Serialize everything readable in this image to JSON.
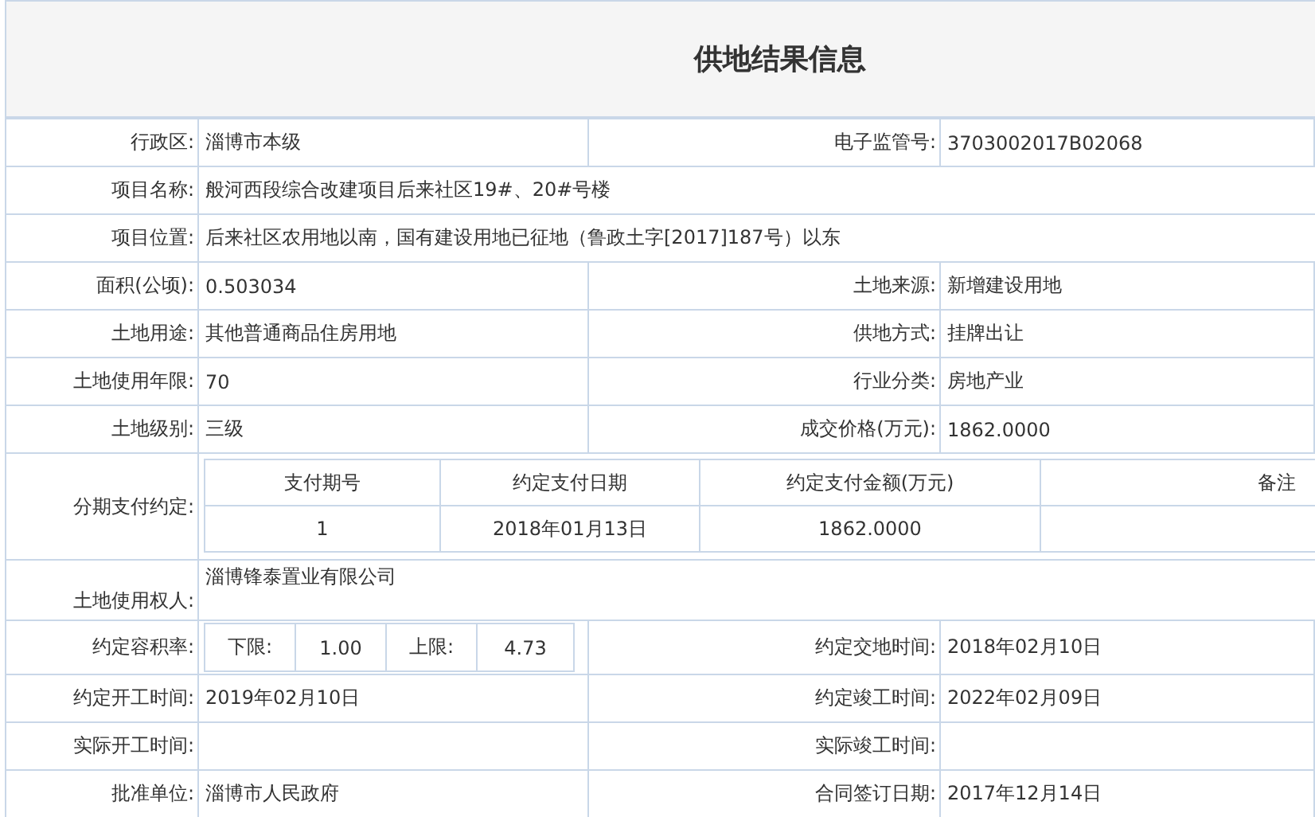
{
  "title": "供地结果信息",
  "rows": [
    {
      "kind": "pair",
      "cells": [
        {
          "label": "行政区:",
          "value": "淄博市本级"
        },
        {
          "label": "电子监管号:",
          "value": "3703002017B02068"
        }
      ]
    },
    {
      "kind": "wide",
      "label": "项目名称:",
      "value": "般河西段综合改建项目后来社区19#、20#号楼"
    },
    {
      "kind": "wide",
      "label": "项目位置:",
      "value": "后来社区农用地以南，国有建设用地已征地（鲁政土字[2017]187号）以东"
    },
    {
      "kind": "pair",
      "cells": [
        {
          "label": "面积(公顷):",
          "value": "0.503034"
        },
        {
          "label": "土地来源:",
          "value": "新增建设用地"
        }
      ]
    },
    {
      "kind": "pair",
      "cells": [
        {
          "label": "土地用途:",
          "value": "其他普通商品住房用地"
        },
        {
          "label": "供地方式:",
          "value": "挂牌出让"
        }
      ]
    },
    {
      "kind": "pair",
      "cells": [
        {
          "label": "土地使用年限:",
          "value": "70"
        },
        {
          "label": "行业分类:",
          "value": "房地产业"
        }
      ]
    },
    {
      "kind": "pair",
      "cells": [
        {
          "label": "土地级别:",
          "value": "三级"
        },
        {
          "label": "成交价格(万元):",
          "value": "1862.0000"
        }
      ]
    },
    {
      "kind": "installments",
      "label": "分期支付约定:",
      "columns": [
        "支付期号",
        "约定支付日期",
        "约定支付金额(万元)",
        "备注"
      ],
      "rows": [
        [
          "1",
          "2018年01月13日",
          "1862.0000"
        ]
      ]
    },
    {
      "kind": "owner",
      "label": "土地使用权人:",
      "value": "淄博锋泰置业有限公司"
    },
    {
      "kind": "ratio",
      "label": "约定容积率:",
      "lower_label": "下限:",
      "lower": "1.00",
      "upper_label": "上限:",
      "upper": "4.73",
      "right": {
        "label": "约定交地时间:",
        "value": "2018年02月10日"
      }
    },
    {
      "kind": "pair",
      "cells": [
        {
          "label": "约定开工时间:",
          "value": "2019年02月10日"
        },
        {
          "label": "约定竣工时间:",
          "value": "2022年02月09日"
        }
      ]
    },
    {
      "kind": "pair",
      "cells": [
        {
          "label": "实际开工时间:"
        },
        {
          "label": "实际竣工时间:"
        }
      ]
    },
    {
      "kind": "pair",
      "cells": [
        {
          "label": "批准单位:",
          "value": "淄博市人民政府"
        },
        {
          "label": "合同签订日期:",
          "value": "2017年12月14日"
        }
      ]
    }
  ]
}
